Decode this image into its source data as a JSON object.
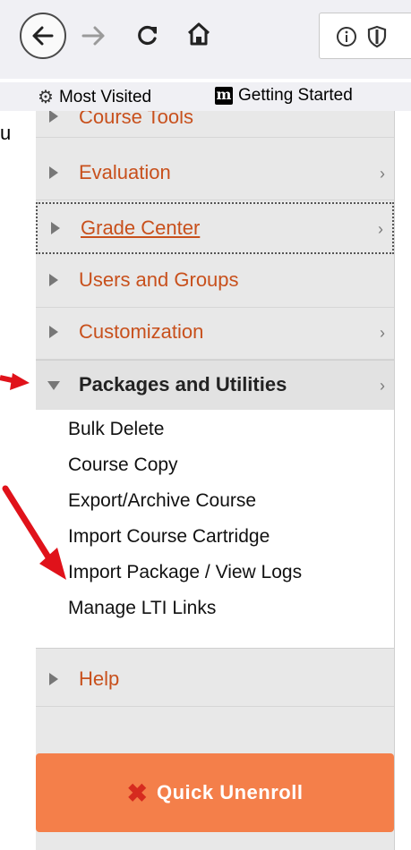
{
  "browser": {
    "bookmarks": [
      {
        "label": "Most Visited",
        "icon": "gear-icon"
      },
      {
        "label": "Getting Started",
        "icon": "m-logo"
      }
    ],
    "left_fragment": "u"
  },
  "course_menu": {
    "items": [
      {
        "label": "Course Tools"
      },
      {
        "label": "Evaluation",
        "chevron": "›"
      },
      {
        "label": "Grade Center",
        "chevron": "›"
      },
      {
        "label": "Users and Groups"
      },
      {
        "label": "Customization",
        "chevron": "›"
      },
      {
        "label": "Packages and Utilities",
        "chevron": "›",
        "expanded": true
      },
      {
        "label": "Help"
      }
    ],
    "packages_subitems": [
      "Bulk Delete",
      "Course Copy",
      "Export/Archive Course",
      "Import Course Cartridge",
      "Import Package / View Logs",
      "Manage LTI Links"
    ],
    "quick_unenroll": {
      "label": "Quick Unenroll",
      "icon": "x-icon"
    }
  },
  "colors": {
    "menu_link": "#c8501c",
    "panel_bg": "#e8e8e8",
    "quick_bg": "#f47f4a",
    "arrow": "#e0121a"
  }
}
